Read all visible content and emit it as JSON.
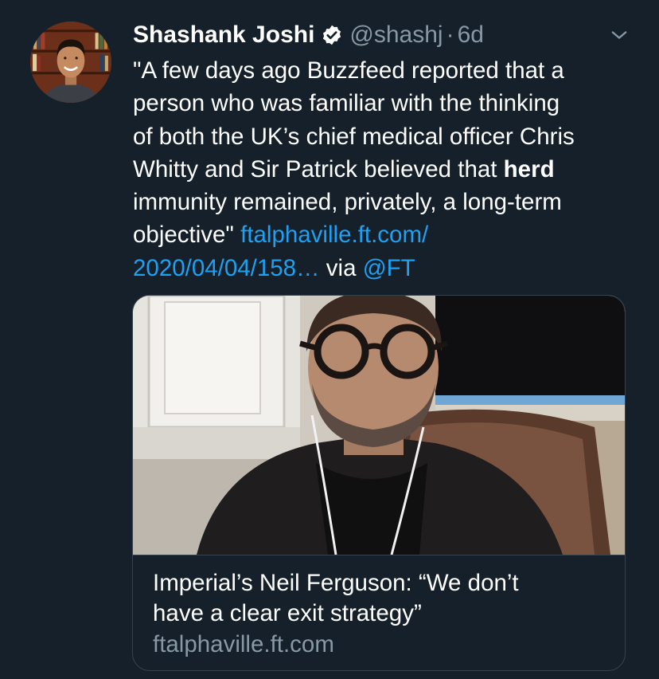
{
  "author": {
    "name": "Shashank Joshi",
    "handle": "@shashj",
    "separator": "·",
    "time": "6d",
    "verified": true,
    "avatar_icon": "profile-photo"
  },
  "tweet": {
    "lines": [
      "\"A few days ago Buzzfeed reported that a",
      "person who was familiar with the thinking",
      "of both the UK’s chief medical officer Chris",
      "Whitty and Sir Patrick believed that",
      "immunity remained, privately, a long-term",
      "objective\""
    ],
    "bold_word": "herd",
    "link_part1": "ftalphaville.ft.com/",
    "link_part2": "2020/04/04/158…",
    "via_text": "via",
    "mention": "@FT"
  },
  "card": {
    "title_line1": "Imperial’s Neil Ferguson: “We don’t",
    "title_line2": "have a clear exit strategy”",
    "domain": "ftalphaville.ft.com",
    "image_icon": "article-photo"
  },
  "colors": {
    "background": "#15202b",
    "text": "#ffffff",
    "secondary": "#8899a6",
    "link": "#1da1f2",
    "border": "#38444d"
  },
  "icons": {
    "verified": "verified-badge-icon",
    "more": "chevron-down-icon"
  }
}
